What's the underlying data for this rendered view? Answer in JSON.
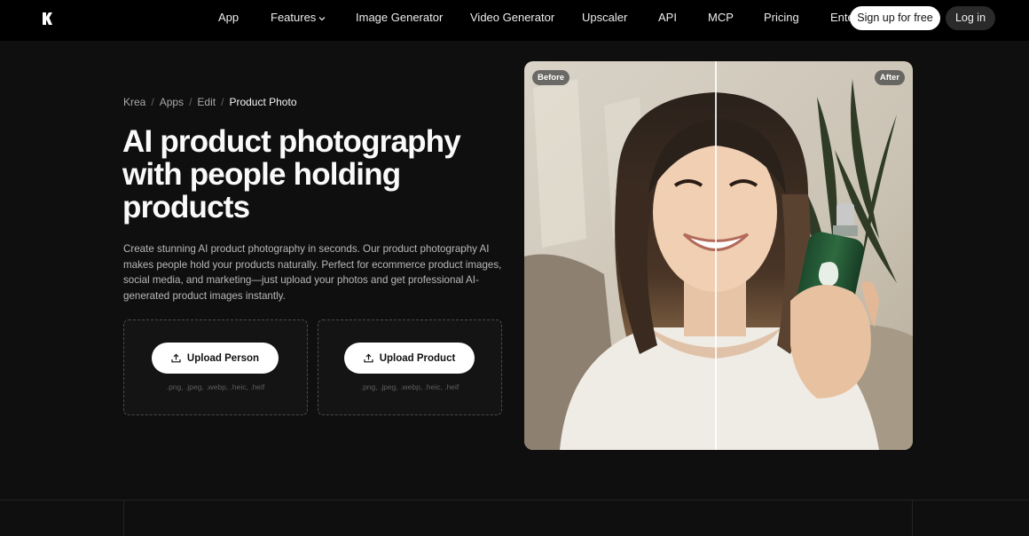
{
  "nav": {
    "items": [
      "App",
      "Features",
      "Image Generator",
      "Video Generator",
      "Upscaler",
      "API",
      "MCP",
      "Pricing",
      "Ente"
    ],
    "signup_label": "Sign up for free",
    "login_label": "Log in"
  },
  "breadcrumb": [
    "Krea",
    "Apps",
    "Edit",
    "Product Photo"
  ],
  "hero": {
    "title": "AI product photography with people holding products",
    "description": "Create stunning AI product photography in seconds. Our product photography AI makes people hold your products naturally. Perfect for ecommerce product images, social media, and marketing—just upload your photos and get professional AI-generated product images instantly."
  },
  "upload": {
    "person_label": "Upload Person",
    "product_label": "Upload Product",
    "formats": ".png, .jpeg, .webp, .heic, .heif"
  },
  "compare": {
    "before_label": "Before",
    "after_label": "After"
  },
  "icons": [
    "krea-logo-icon",
    "chevron-down-icon",
    "upload-icon"
  ]
}
